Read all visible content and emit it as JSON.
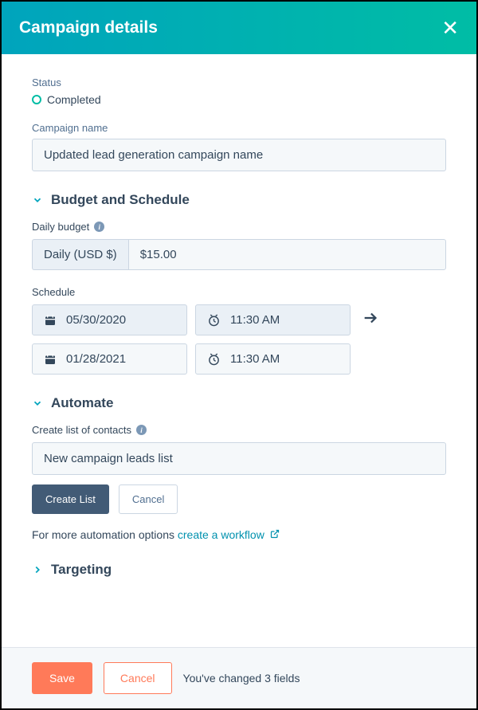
{
  "header": {
    "title": "Campaign details"
  },
  "status": {
    "label": "Status",
    "value": "Completed"
  },
  "campaign_name": {
    "label": "Campaign name",
    "value": "Updated lead generation campaign name"
  },
  "sections": {
    "budget_schedule": "Budget and Schedule",
    "automate": "Automate",
    "targeting": "Targeting"
  },
  "budget": {
    "label": "Daily budget",
    "prefix": "Daily (USD $)",
    "value": "$15.00"
  },
  "schedule": {
    "label": "Schedule",
    "start_date": "05/30/2020",
    "start_time": "11:30 AM",
    "end_date": "01/28/2021",
    "end_time": "11:30 AM"
  },
  "automate": {
    "contacts_label": "Create list of contacts",
    "list_name": "New campaign leads list",
    "create_btn": "Create List",
    "cancel_btn": "Cancel",
    "more_text": "For more automation options ",
    "workflow_link": "create a workflow"
  },
  "footer": {
    "save": "Save",
    "cancel": "Cancel",
    "changed": "You've changed 3 fields"
  }
}
